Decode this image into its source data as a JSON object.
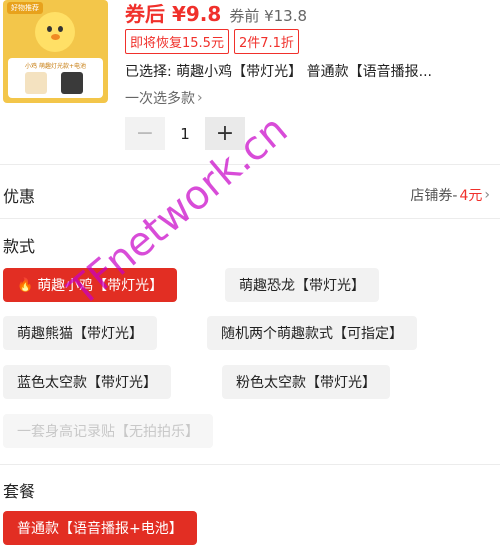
{
  "product": {
    "thumb_tag": "好物推荐",
    "thumb_caption": "小鸡 萌趣灯光款+电池"
  },
  "price": {
    "after": "券后 ¥9.8",
    "before": "券前 ¥13.8"
  },
  "tags": [
    "即将恢复15.5元",
    "2件7.1折"
  ],
  "selected_text": "已选择: 萌趣小鸡【带灯光】 普通款【语音播报...",
  "multi_select": "一次选多款",
  "quantity": {
    "minus": "−",
    "value": "1",
    "plus": "+"
  },
  "offers": {
    "title": "优惠",
    "coupon_label": "店铺券-",
    "coupon_amount": "4元"
  },
  "style_section": {
    "title": "款式",
    "options": [
      {
        "label": "萌趣小鸡【带灯光】",
        "state": "selected"
      },
      {
        "label": "萌趣恐龙【带灯光】",
        "state": "normal"
      },
      {
        "label": "萌趣熊猫【带灯光】",
        "state": "normal"
      },
      {
        "label": "随机两个萌趣款式【可指定】",
        "state": "normal"
      },
      {
        "label": "蓝色太空款【带灯光】",
        "state": "normal"
      },
      {
        "label": "粉色太空款【带灯光】",
        "state": "normal"
      },
      {
        "label": "一套身高记录贴【无拍拍乐】",
        "state": "disabled"
      }
    ]
  },
  "package_section": {
    "title": "套餐",
    "options": [
      {
        "label": "普通款【语音播报+电池】",
        "state": "selected"
      }
    ]
  },
  "watermark": "TFnetwork.cn",
  "colors": {
    "accent": "#f0302b",
    "chip_active": "#e22e23",
    "chip_bg": "#f2f2f2"
  }
}
